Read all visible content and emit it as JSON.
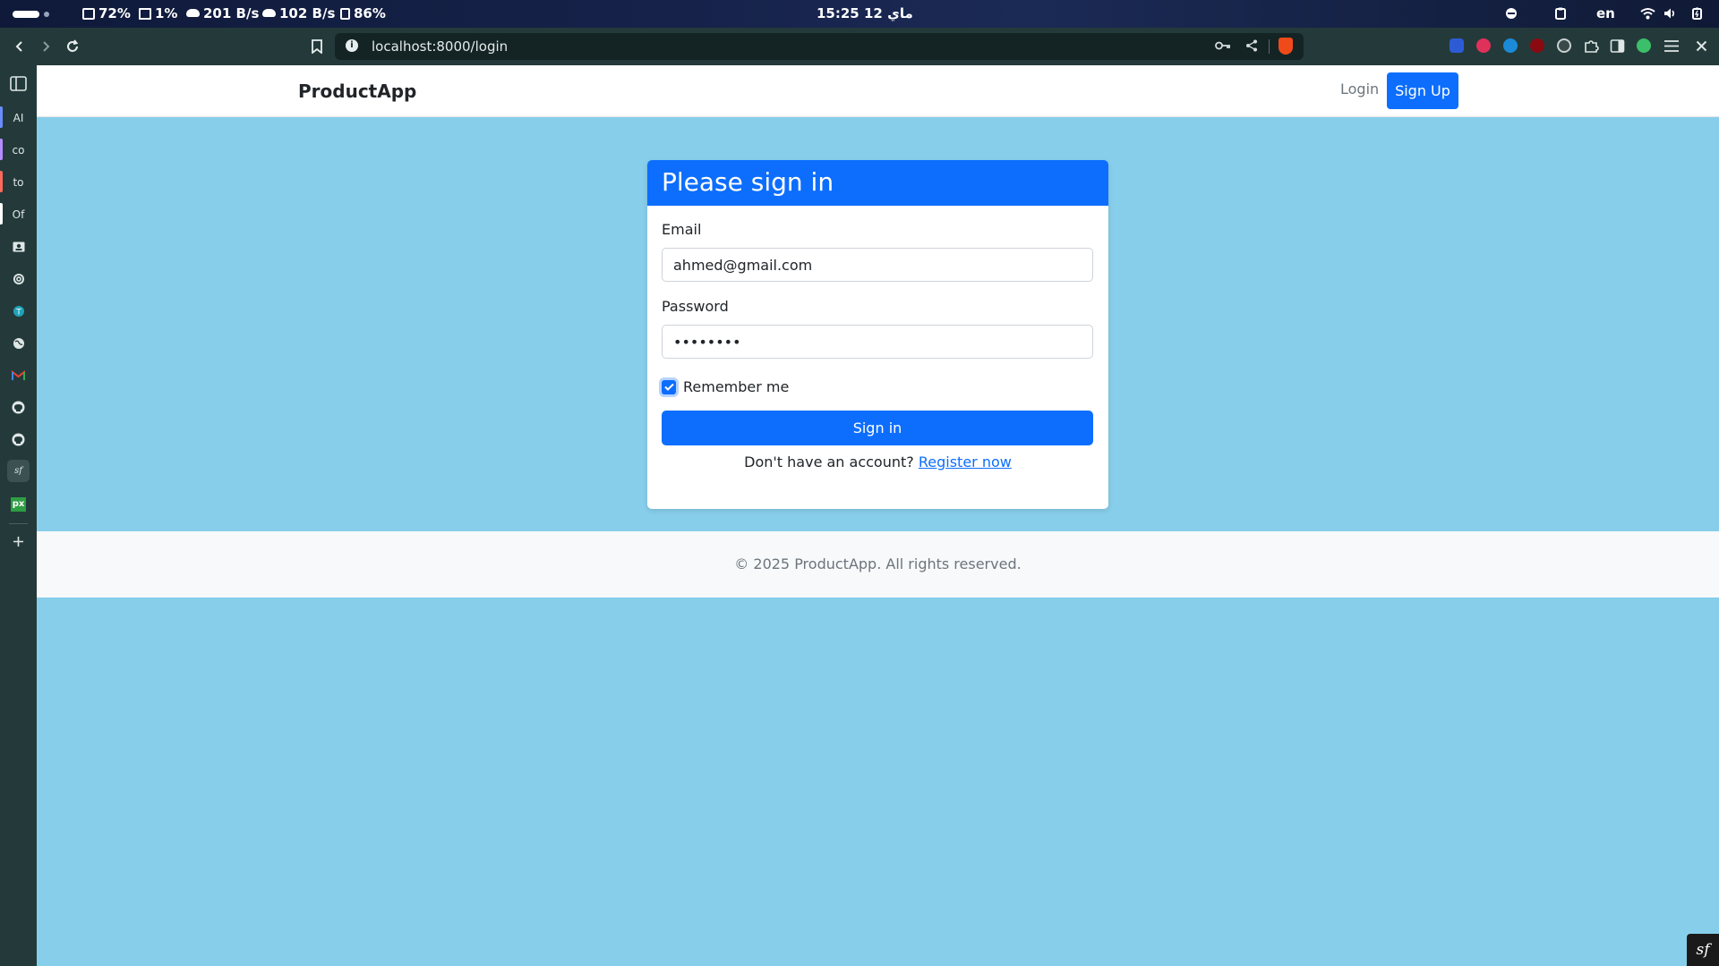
{
  "system_bar": {
    "cpu": "72%",
    "disk": "1%",
    "download": "201 B/s",
    "upload": "102 B/s",
    "memory": "86%",
    "clock": "15:25  12 ماي",
    "lang": "en"
  },
  "browser": {
    "url": "localhost:8000/login"
  },
  "sidebar": {
    "items": [
      {
        "label": "AI",
        "accent": "#6a8cff"
      },
      {
        "label": "co",
        "accent": "#b58cff"
      },
      {
        "label": "to",
        "accent": "#ff6a5c"
      },
      {
        "label": "Of",
        "accent": "#ffffff"
      }
    ]
  },
  "navbar": {
    "brand": "ProductApp",
    "login": "Login",
    "signup": "Sign Up"
  },
  "login_card": {
    "title": "Please sign in",
    "email_label": "Email",
    "email_value": "ahmed@gmail.com",
    "password_label": "Password",
    "password_value": "password",
    "remember_label": "Remember me",
    "remember_checked": true,
    "submit": "Sign in",
    "register_prompt": "Don't have an account?",
    "register_link": "Register now"
  },
  "footer": {
    "text": "© 2025 ProductApp. All rights reserved."
  },
  "colors": {
    "primary": "#0d6efd",
    "page_bg": "#87ceeb",
    "muted": "#6c757d"
  }
}
